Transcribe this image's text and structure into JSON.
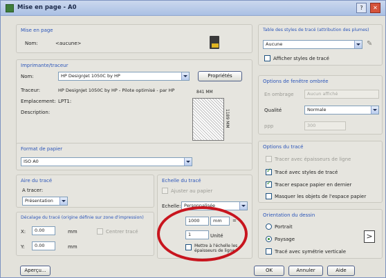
{
  "window": {
    "title": "Mise en page - A0"
  },
  "mise_en_page": {
    "title": "Mise en page",
    "nom_label": "Nom:",
    "nom_value": "<aucune>"
  },
  "imprimante": {
    "title": "Imprimante/traceur",
    "nom_label": "Nom:",
    "nom_value": "HP DesignJet 1050C by HP",
    "properties_button": "Propriétés",
    "traceur_label": "Traceur:",
    "traceur_value": "HP DesignJet 1050C by HP - Pilote optimisé - par HP",
    "emplacement_label": "Emplacement:",
    "emplacement_value": "LPT1:",
    "description_label": "Description:",
    "preview_width": "841 MM",
    "preview_height": "1189 MM"
  },
  "format": {
    "title": "Format de papier",
    "value": "ISO A0"
  },
  "aire": {
    "title": "Aire du tracé",
    "label": "A tracer:",
    "value": "Présentation"
  },
  "decalage": {
    "title": "Décalage du tracé (origine définie sur zone d'impression)",
    "x_label": "X:",
    "x_value": "0.00",
    "x_unit": "mm",
    "y_label": "Y:",
    "y_value": "0.00",
    "y_unit": "mm",
    "center_label": "Centrer tracé"
  },
  "echelle": {
    "title": "Echelle du tracé",
    "fit_label": "Ajuster au papier",
    "echelle_label": "Echelle:",
    "echelle_value": "Personnalisée",
    "value1": "1000",
    "unit1": "mm",
    "eq": "=",
    "value2": "1",
    "unit2": "Unité",
    "lineweights_label": "Mettre à l'échelle les épaisseurs de ligne"
  },
  "styles": {
    "title": "Table des styles de tracé (attribution des plumes)",
    "value": "Aucune",
    "show_label": "Afficher styles de tracé"
  },
  "fenetre": {
    "title": "Options de fenêtre ombrée",
    "ombre_label": "En ombrage",
    "ombre_value": "Aucun affiché",
    "qualite_label": "Qualité",
    "qualite_value": "Normale",
    "ppp_label": "ppp",
    "ppp_value": "300"
  },
  "options": {
    "title": "Options du tracé",
    "items": [
      "Tracer avec épaisseurs de ligne",
      "Tracé avec styles de tracé",
      "Tracer espace papier en dernier",
      "Masquer les objets de l'espace papier"
    ]
  },
  "orientation": {
    "title": "Orientation du dessin",
    "portrait": "Portrait",
    "paysage": "Paysage",
    "inverse": "Tracé avec symétrie verticale"
  },
  "footer": {
    "apercu": "Aperçu...",
    "ok": "OK",
    "annuler": "Annuler",
    "aide": "Aide"
  }
}
